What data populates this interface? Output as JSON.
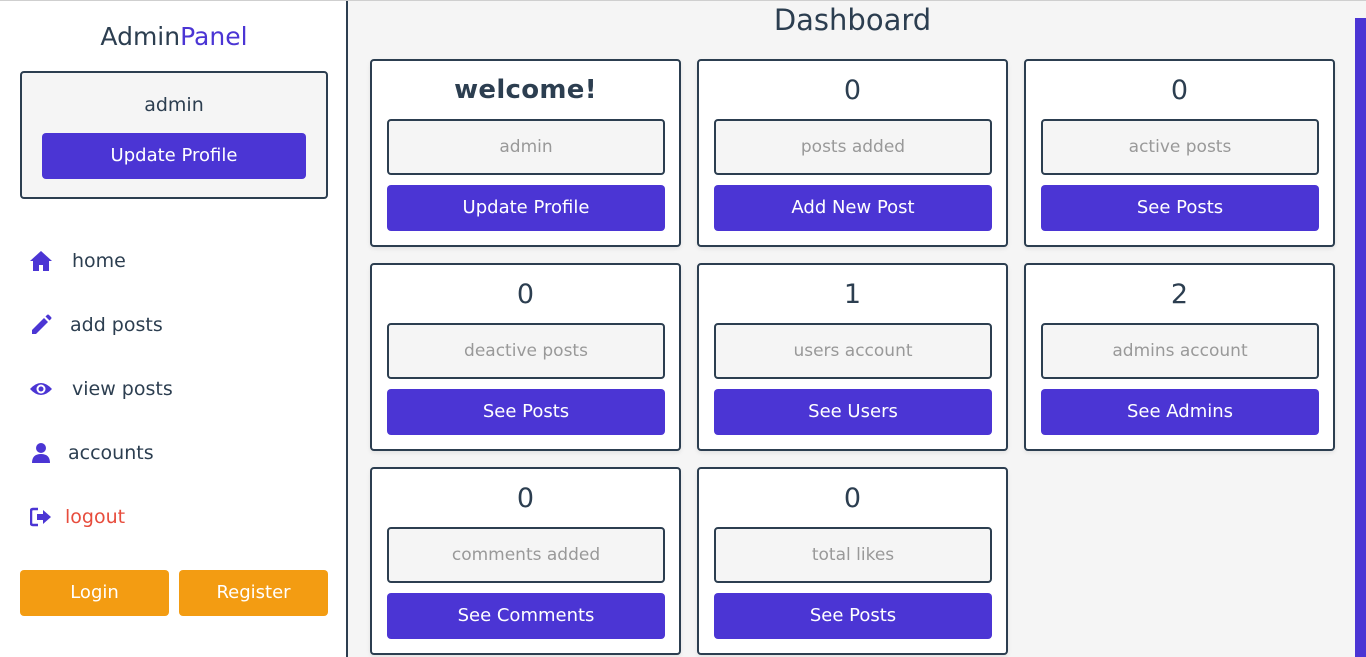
{
  "sidebar": {
    "logo": {
      "part1": "Admin",
      "part2": "Panel"
    },
    "profile": {
      "name": "admin",
      "update_button": "Update Profile"
    },
    "nav": [
      {
        "label": "home",
        "icon": "home-icon"
      },
      {
        "label": "add posts",
        "icon": "pencil-icon"
      },
      {
        "label": "view posts",
        "icon": "eye-icon"
      },
      {
        "label": "accounts",
        "icon": "user-icon"
      },
      {
        "label": "logout",
        "icon": "sign-out-icon"
      }
    ],
    "login_button": "Login",
    "register_button": "Register"
  },
  "main": {
    "title": "Dashboard",
    "cards": [
      {
        "count": "welcome!",
        "desc": "admin",
        "button": "Update Profile"
      },
      {
        "count": "0",
        "desc": "posts added",
        "button": "Add New Post"
      },
      {
        "count": "0",
        "desc": "active posts",
        "button": "See Posts"
      },
      {
        "count": "0",
        "desc": "deactive posts",
        "button": "See Posts"
      },
      {
        "count": "1",
        "desc": "users account",
        "button": "See Users"
      },
      {
        "count": "2",
        "desc": "admins account",
        "button": "See Admins"
      },
      {
        "count": "0",
        "desc": "comments added",
        "button": "See Comments"
      },
      {
        "count": "0",
        "desc": "total likes",
        "button": "See Posts"
      }
    ]
  },
  "colors": {
    "primary": "#4b35d4",
    "orange": "#f39c12",
    "text": "#2c3e50",
    "logout": "#e74c3c",
    "background": "#f5f5f5"
  }
}
